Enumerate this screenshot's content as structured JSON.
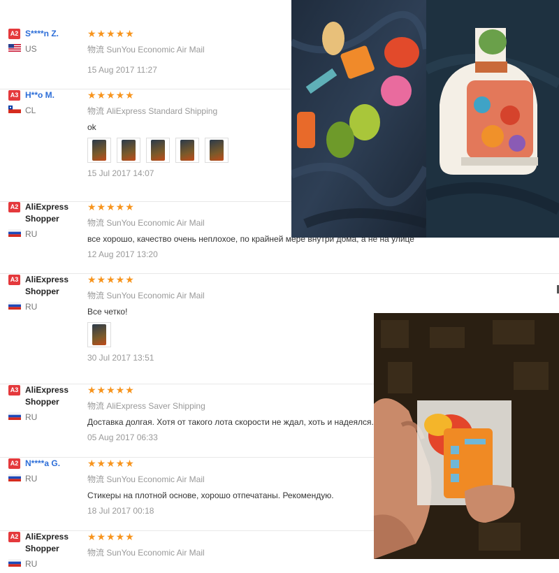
{
  "reviews": [
    {
      "badge": "A2",
      "name": "S****n Z.",
      "name_style": "link",
      "flag": "us",
      "country": "US",
      "stars": "★★★★★",
      "ship_icon": "物流",
      "shipping": "SunYou Economic Air Mail",
      "text": "",
      "thumbs": 0,
      "date": "15 Aug 2017 11:27"
    },
    {
      "badge": "A3",
      "name": "H**o M.",
      "name_style": "link",
      "flag": "cl",
      "country": "CL",
      "stars": "★★★★★",
      "ship_icon": "物流",
      "shipping": "AliExpress Standard Shipping",
      "text": "ok",
      "thumbs": 5,
      "date": "15 Jul 2017 14:07"
    },
    {
      "badge": "A2",
      "name": "AliExpress Shopper",
      "name_style": "shop",
      "flag": "ru",
      "country": "RU",
      "stars": "★★★★★",
      "ship_icon": "物流",
      "shipping": "SunYou Economic Air Mail",
      "text": "все хорошо, качество очень неплохое, по крайней мере внутри дома, а не на улице",
      "thumbs": 0,
      "date": "12 Aug 2017 13:20"
    },
    {
      "badge": "A3",
      "name": "AliExpress Shopper",
      "name_style": "shop",
      "flag": "ru",
      "country": "RU",
      "stars": "★★★★★",
      "ship_icon": "物流",
      "shipping": "SunYou Economic Air Mail",
      "text": "Все четко!",
      "thumbs": 1,
      "date": "30 Jul 2017 13:51"
    },
    {
      "badge": "A3",
      "name": "AliExpress Shopper",
      "name_style": "shop",
      "flag": "ru",
      "country": "RU",
      "stars": "★★★★★",
      "ship_icon": "物流",
      "shipping": "AliExpress Saver Shipping",
      "text": "Доставка долгая. Хотя от такого лота скорости не ждал, хоть и надеялся.",
      "thumbs": 0,
      "date": "05 Aug 2017 06:33"
    },
    {
      "badge": "A2",
      "name": "N****a G.",
      "name_style": "link",
      "flag": "ru",
      "country": "RU",
      "stars": "★★★★★",
      "ship_icon": "物流",
      "shipping": "SunYou Economic Air Mail",
      "text": "Стикеры на плотной основе, хорошо отпечатаны. Рекомендую.",
      "thumbs": 0,
      "date": "18 Jul 2017 00:18"
    },
    {
      "badge": "A2",
      "name": "AliExpress Shopper",
      "name_style": "shop",
      "flag": "ru",
      "country": "RU",
      "stars": "★★★★★",
      "ship_icon": "物流",
      "shipping": "SunYou Economic Air Mail",
      "text": "",
      "thumbs": 0,
      "date": ""
    }
  ]
}
